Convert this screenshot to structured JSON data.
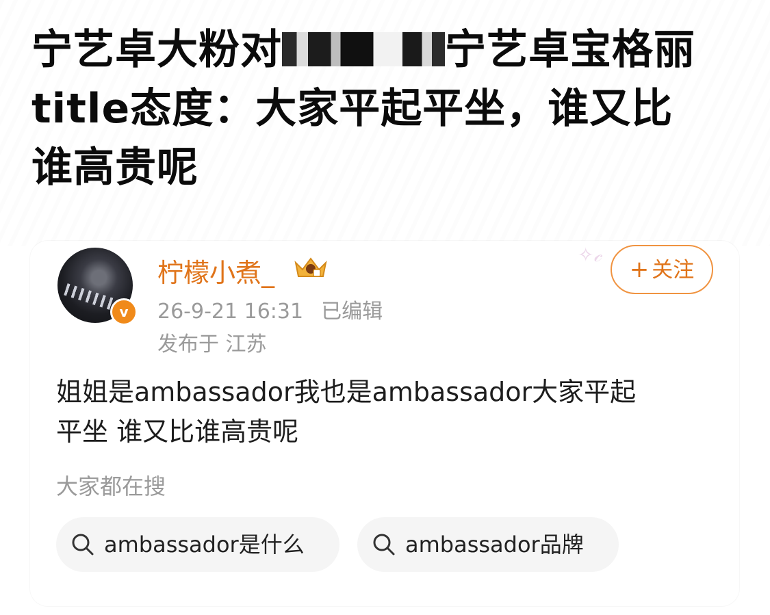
{
  "headline": {
    "line1_before": "宁艺卓大粉对",
    "line1_after": "宁艺卓宝格丽",
    "line2": "title态度：大家平起平坐，谁又比",
    "line3": "谁高贵呢"
  },
  "post": {
    "username": "柠檬小煮_",
    "timestamp": "26-9-21 16:31",
    "edited_label": "已编辑",
    "location": "发布于 江苏",
    "follow_label": "关注",
    "follow_plus": "+",
    "text_line1": "姐姐是ambassador我也是ambassador大家平起",
    "text_line2": "平坐 谁又比谁高贵呢",
    "verified_mark": "v"
  },
  "search": {
    "label": "大家都在搜",
    "chips": [
      {
        "text": "ambassador是什么"
      },
      {
        "text": "ambassador品牌"
      }
    ]
  },
  "colors": {
    "accent": "#e0741a",
    "follow_border": "#f09340",
    "muted_text": "#9a9a9a",
    "chip_bg": "#f5f5f5",
    "headline": "#0b0b0b"
  },
  "icons": [
    "verified-badge-icon",
    "crown-badge-icon",
    "search-icon"
  ]
}
